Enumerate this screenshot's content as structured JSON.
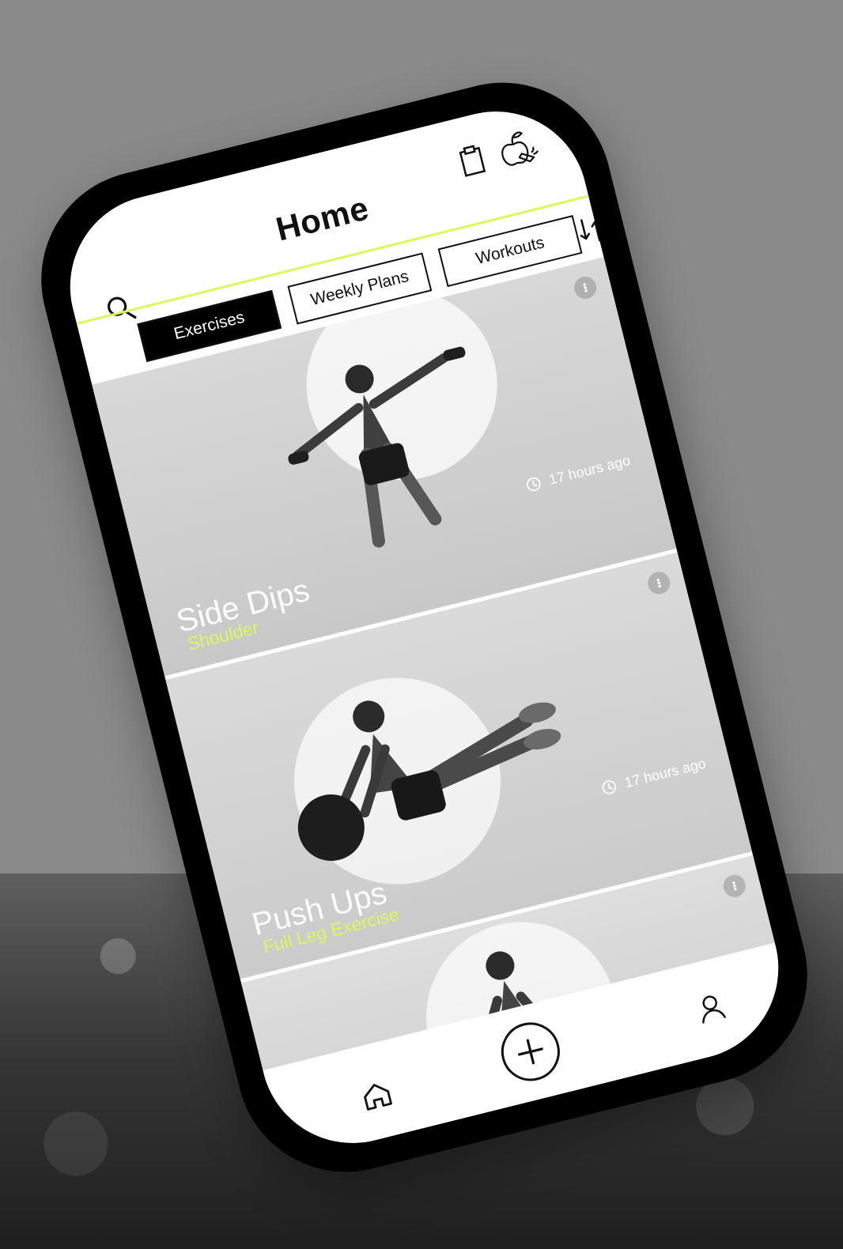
{
  "app": {
    "title": "Home"
  },
  "tabs": {
    "exercises": "Exercises",
    "weekly_plans": "Weekly Plans",
    "workouts": "Workouts"
  },
  "cards": [
    {
      "title": "Side Dips",
      "subtitle": "Shoulder",
      "time": "17 hours ago"
    },
    {
      "title": "Push Ups",
      "subtitle": "Full Leg Exercise",
      "time": "17 hours ago"
    },
    {
      "title": "",
      "subtitle": "",
      "time": ""
    }
  ],
  "colors": {
    "accent": "#daf95a",
    "dark": "#111111",
    "surface": "#ffffff",
    "background": "#8a8a8a"
  },
  "icons": {
    "search": "search-icon",
    "clipboard": "clipboard-icon",
    "nutrition": "nutrition-icon",
    "sort": "sort-icon",
    "menu": "kebab-menu-icon",
    "clock": "clock-icon",
    "home": "home-icon",
    "add": "plus-icon",
    "profile": "profile-icon"
  }
}
